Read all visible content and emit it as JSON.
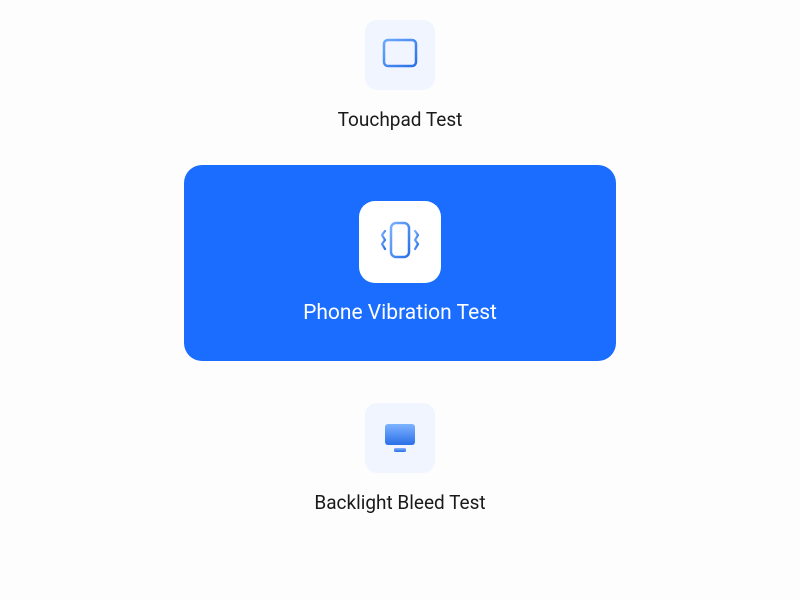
{
  "colors": {
    "accent": "#1a6dff",
    "tile_bg": "#f0f5ff",
    "selected_bg": "#1a6dff",
    "selected_tile": "#ffffff",
    "text_normal": "#1a1a1a",
    "text_selected": "#ffffff"
  },
  "tests": [
    {
      "id": "touchpad",
      "label": "Touchpad Test",
      "icon": "touchpad-icon",
      "selected": false
    },
    {
      "id": "phone-vibration",
      "label": "Phone Vibration Test",
      "icon": "vibration-icon",
      "selected": true
    },
    {
      "id": "backlight-bleed",
      "label": "Backlight Bleed Test",
      "icon": "monitor-icon",
      "selected": false
    }
  ]
}
